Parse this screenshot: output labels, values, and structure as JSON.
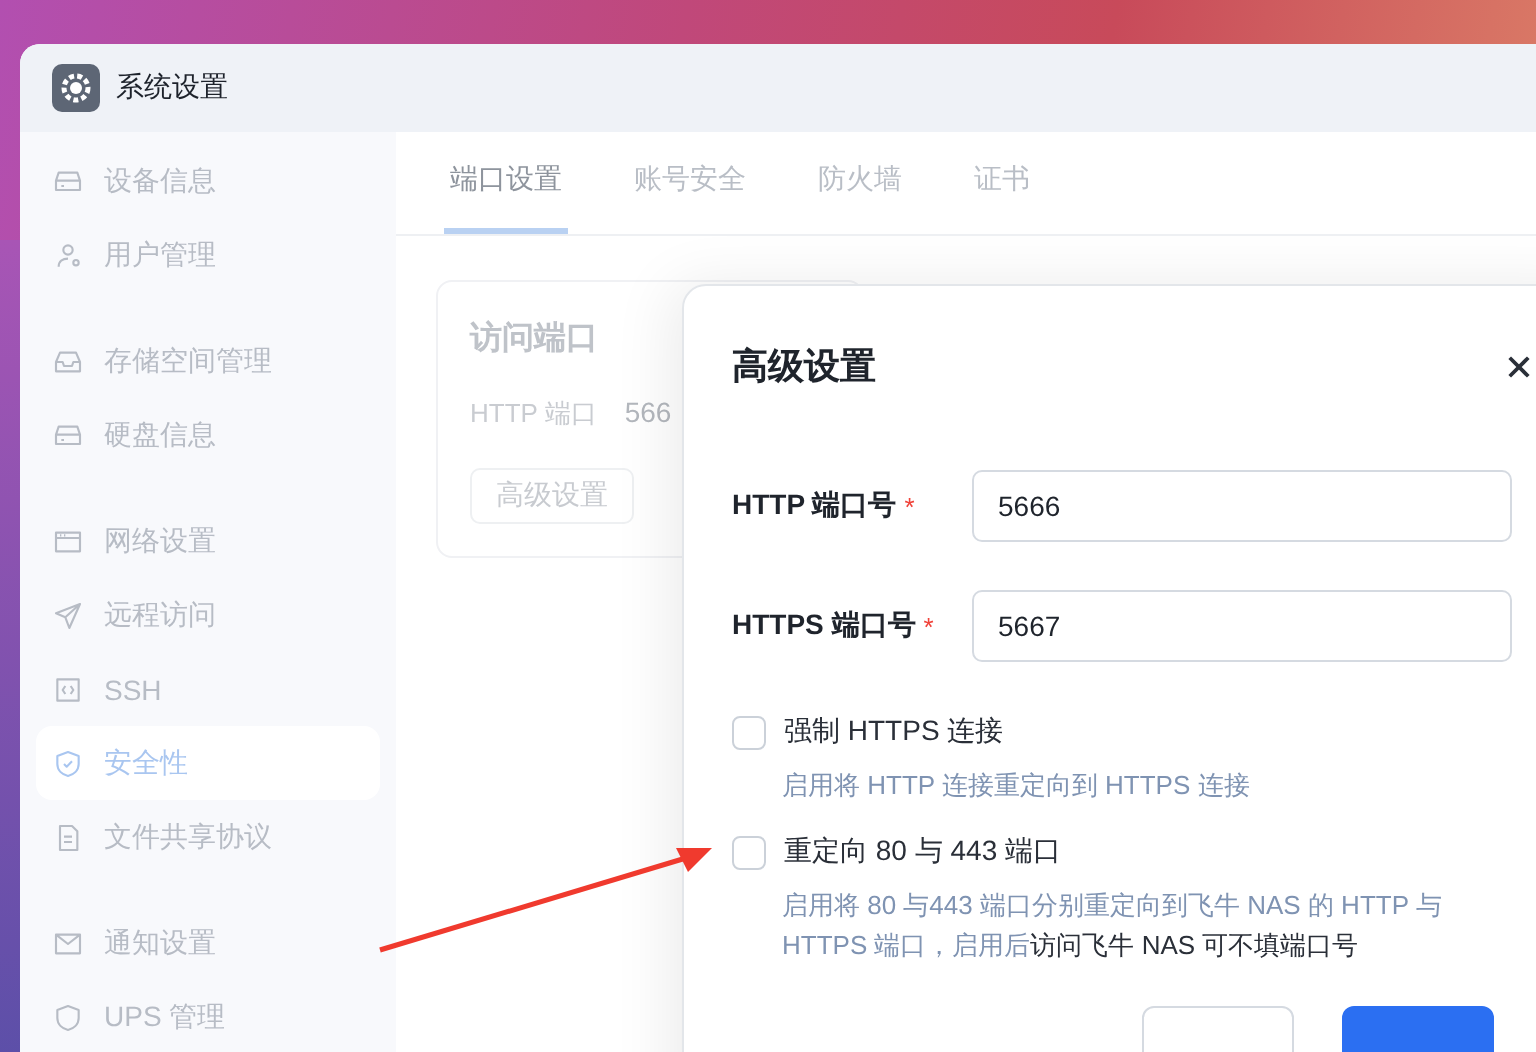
{
  "window": {
    "title": "系统设置"
  },
  "sidebar": {
    "groups": [
      {
        "items": [
          {
            "label": "设备信息",
            "selected": false
          },
          {
            "label": "用户管理",
            "selected": false
          }
        ]
      },
      {
        "items": [
          {
            "label": "存储空间管理",
            "selected": false
          },
          {
            "label": "硬盘信息",
            "selected": false
          }
        ]
      },
      {
        "items": [
          {
            "label": "网络设置",
            "selected": false
          },
          {
            "label": "远程访问",
            "selected": false
          },
          {
            "label": "SSH",
            "selected": false
          },
          {
            "label": "安全性",
            "selected": true
          },
          {
            "label": "文件共享协议",
            "selected": false
          }
        ]
      },
      {
        "items": [
          {
            "label": "通知设置",
            "selected": false
          },
          {
            "label": "UPS 管理",
            "selected": false
          }
        ]
      }
    ]
  },
  "tabs": [
    {
      "label": "端口设置",
      "selected": true
    },
    {
      "label": "账号安全",
      "selected": false
    },
    {
      "label": "防火墙",
      "selected": false
    },
    {
      "label": "证书",
      "selected": false
    }
  ],
  "card": {
    "title": "访问端口",
    "field_label": "HTTP 端口",
    "field_value": "566",
    "button": "高级设置"
  },
  "dialog": {
    "title": "高级设置",
    "fields": [
      {
        "label": "HTTP 端口号",
        "required_mark": "*",
        "value": "5666"
      },
      {
        "label": "HTTPS 端口号",
        "required_mark": "*",
        "value": "5667"
      }
    ],
    "options": [
      {
        "label": "强制 HTTPS 连接",
        "checked": false,
        "description": [
          {
            "text": "启用将 HTTP 连接重定向到 HTTPS 连接",
            "highlight": false
          }
        ]
      },
      {
        "label": "重定向 80 与 443 端口",
        "checked": false,
        "description": [
          {
            "text": "启用将 80 与443 端口分别重定向到飞牛 NAS 的 HTTP 与 HTTPS 端口，启用后",
            "highlight": false
          },
          {
            "text": "访问飞牛 NAS 可不填端口号",
            "highlight": true
          }
        ]
      }
    ]
  }
}
